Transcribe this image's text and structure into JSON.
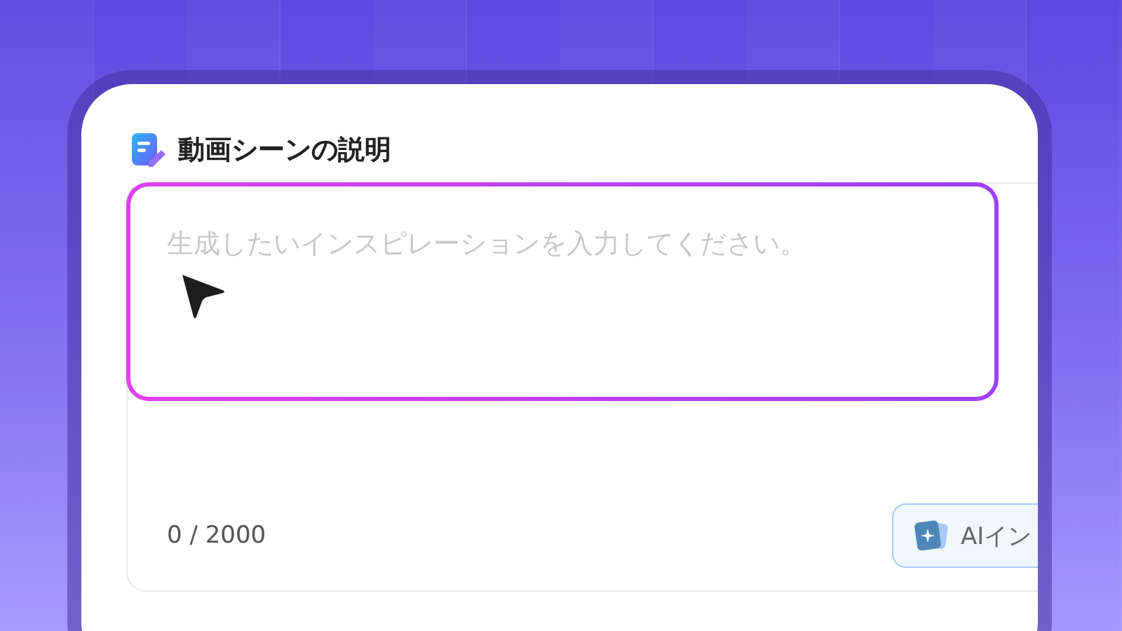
{
  "section": {
    "title": "動画シーンの説明"
  },
  "prompt": {
    "placeholder": "生成したいインスピレーションを入力してください。",
    "counter": "0 / 2000"
  },
  "ai_button": {
    "label": "AIイン"
  }
}
